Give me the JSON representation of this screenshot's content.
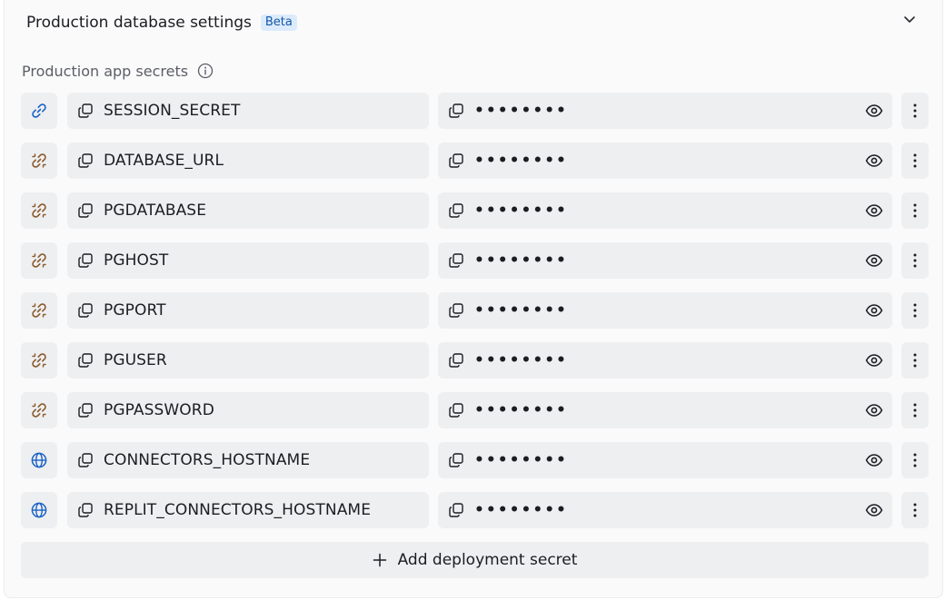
{
  "header": {
    "title": "Production database settings",
    "badge": "Beta",
    "collapse_icon": "chevron-down-icon"
  },
  "section": {
    "label": "Production app secrets",
    "info_icon": "info-icon"
  },
  "colors": {
    "link_blue": "#1b63c6",
    "linked_brown": "#8a5a2b",
    "field_bg": "#eeeff1"
  },
  "secrets": [
    {
      "type_icon": "link-icon",
      "key": "SESSION_SECRET",
      "value": "••••••••"
    },
    {
      "type_icon": "unlink-icon",
      "key": "DATABASE_URL",
      "value": "••••••••"
    },
    {
      "type_icon": "unlink-icon",
      "key": "PGDATABASE",
      "value": "••••••••"
    },
    {
      "type_icon": "unlink-icon",
      "key": "PGHOST",
      "value": "••••••••"
    },
    {
      "type_icon": "unlink-icon",
      "key": "PGPORT",
      "value": "••••••••"
    },
    {
      "type_icon": "unlink-icon",
      "key": "PGUSER",
      "value": "••••••••"
    },
    {
      "type_icon": "unlink-icon",
      "key": "PGPASSWORD",
      "value": "••••••••"
    },
    {
      "type_icon": "globe-icon",
      "key": "CONNECTORS_HOSTNAME",
      "value": "••••••••"
    },
    {
      "type_icon": "globe-icon",
      "key": "REPLIT_CONNECTORS_HOSTNAME",
      "value": "••••••••"
    }
  ],
  "add_button": {
    "label": "Add deployment secret",
    "icon": "plus-icon"
  }
}
